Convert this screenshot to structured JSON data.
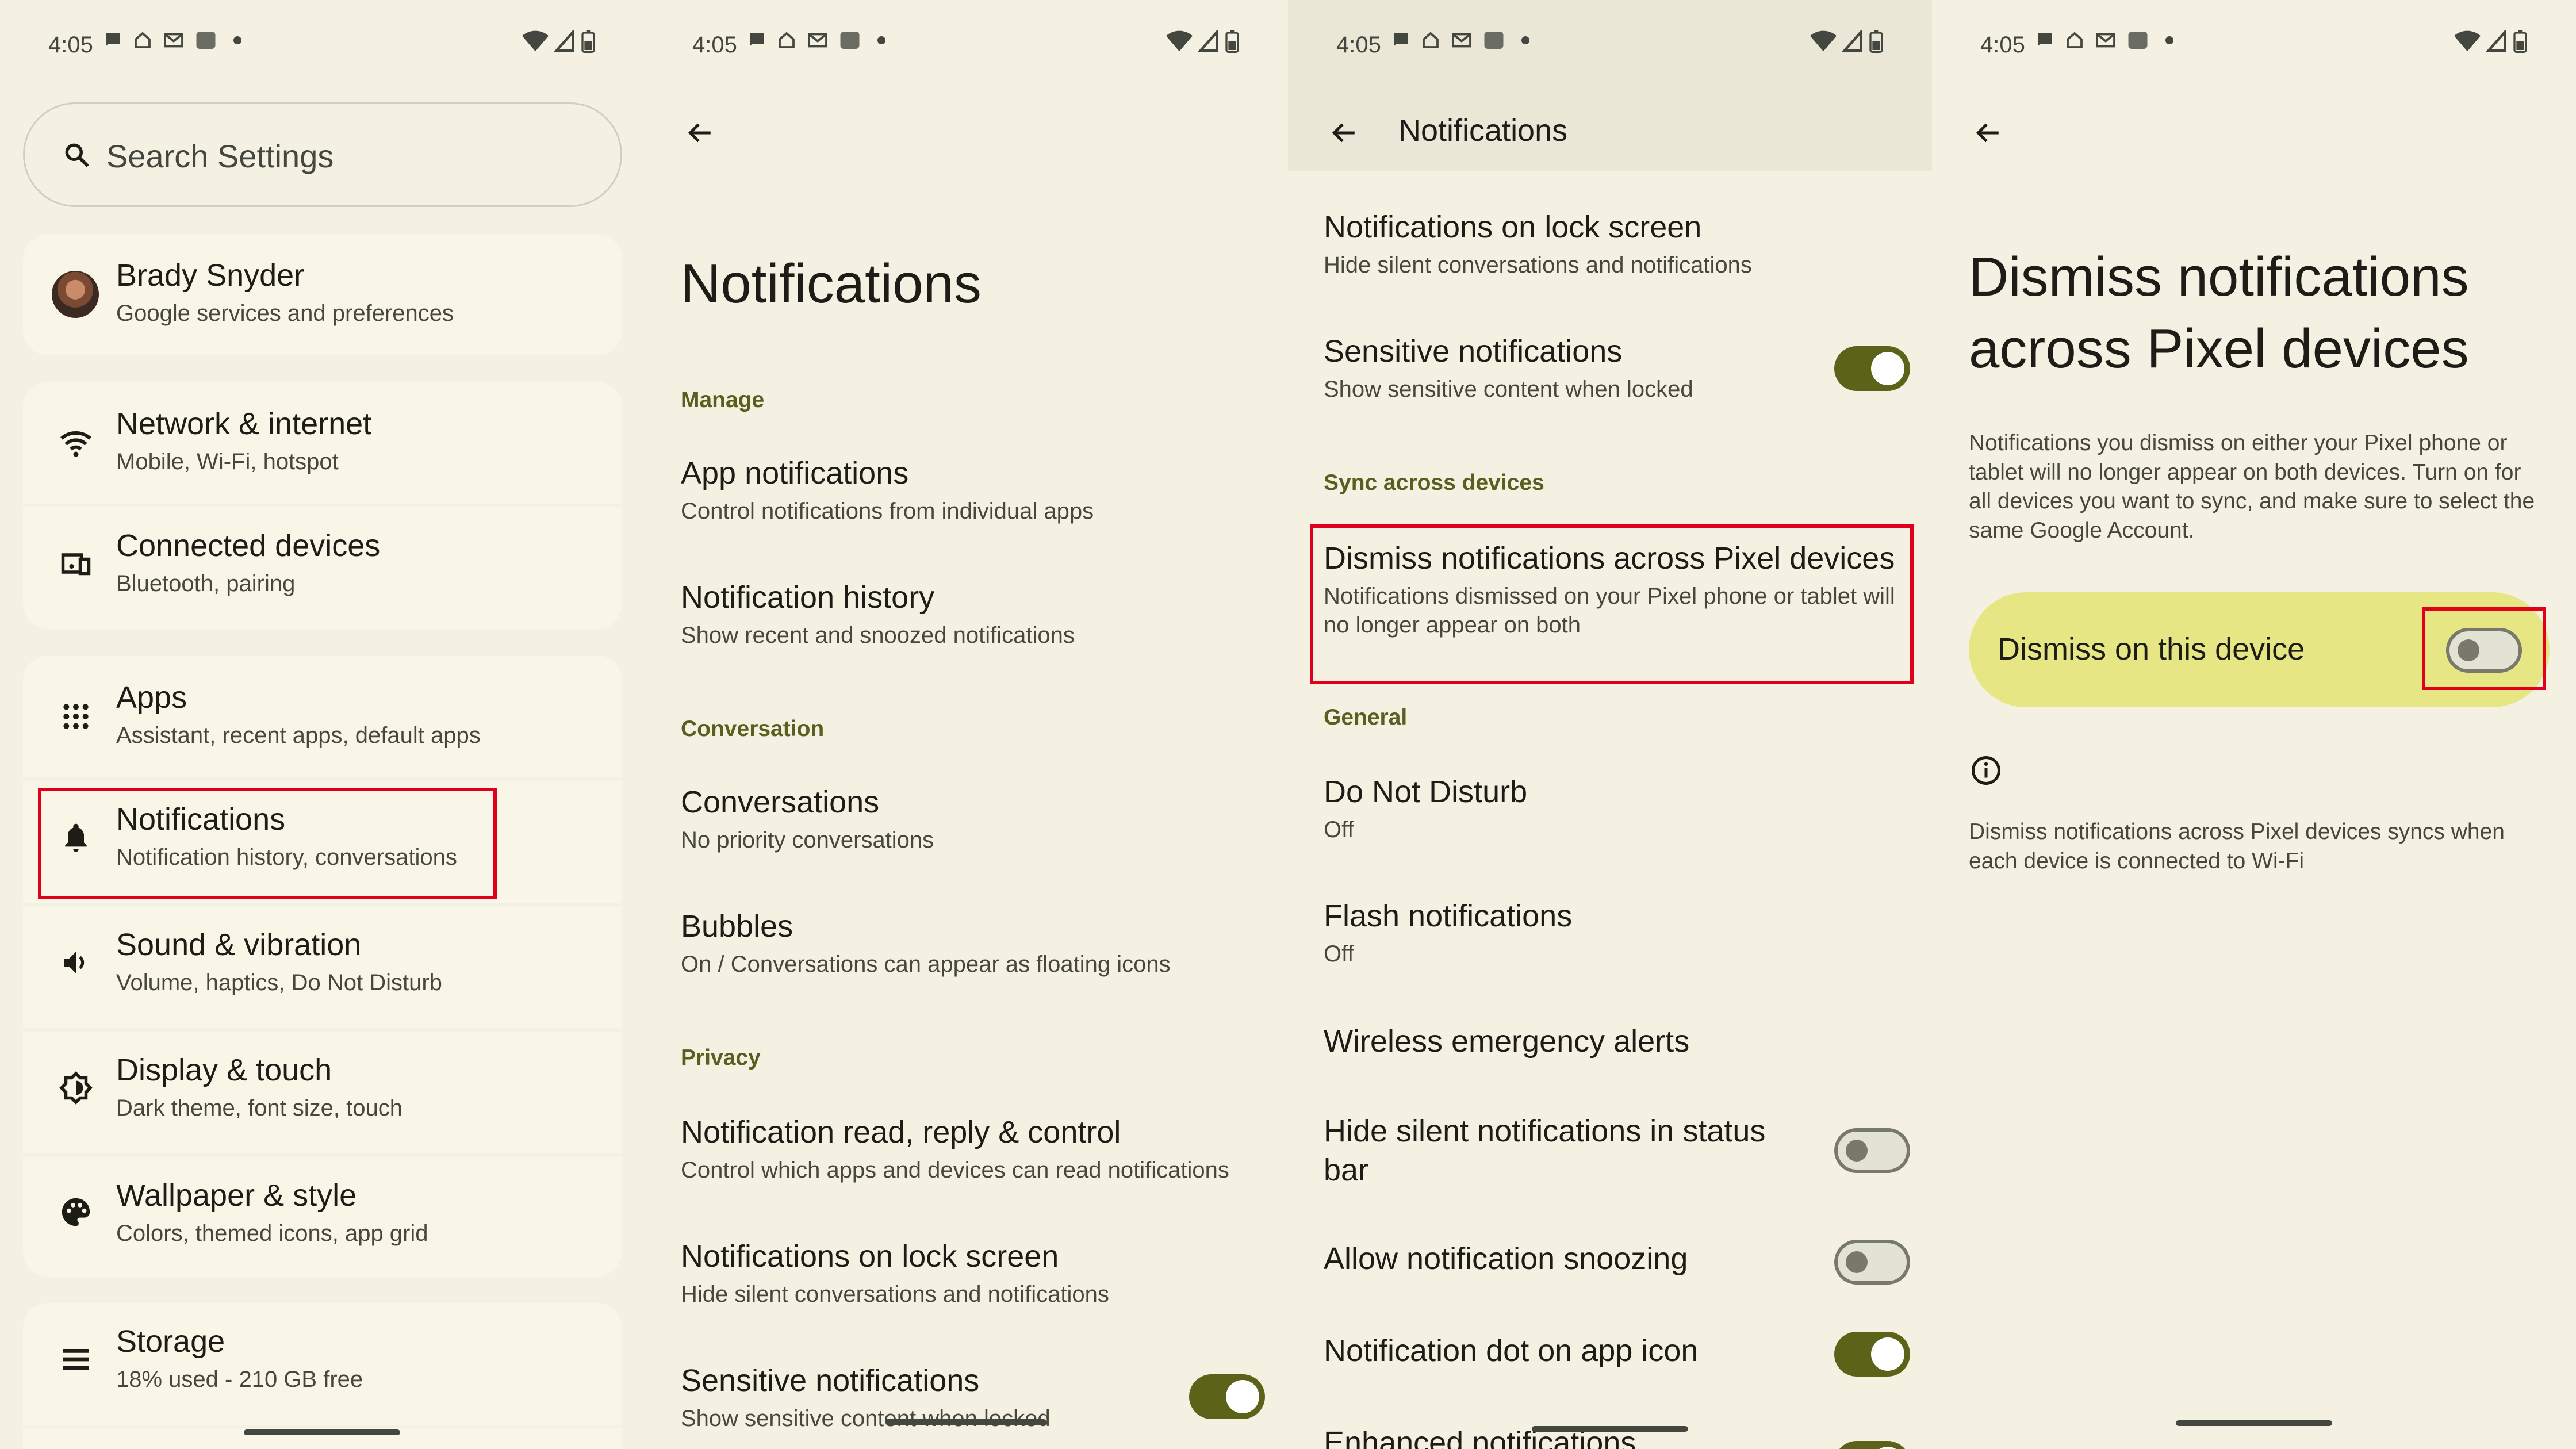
{
  "status_bar": {
    "time": "4:05"
  },
  "panel1": {
    "search_placeholder": "Search Settings",
    "account": {
      "name": "Brady Snyder",
      "subtitle": "Google services and preferences"
    },
    "items": [
      {
        "title": "Network & internet",
        "subtitle": "Mobile, Wi-Fi, hotspot",
        "icon": "wifi-icon"
      },
      {
        "title": "Connected devices",
        "subtitle": "Bluetooth, pairing",
        "icon": "devices-icon"
      },
      {
        "title": "Apps",
        "subtitle": "Assistant, recent apps, default apps",
        "icon": "apps-grid-icon"
      },
      {
        "title": "Notifications",
        "subtitle": "Notification history, conversations",
        "icon": "bell-icon"
      },
      {
        "title": "Sound & vibration",
        "subtitle": "Volume, haptics, Do Not Disturb",
        "icon": "speaker-icon"
      },
      {
        "title": "Display & touch",
        "subtitle": "Dark theme, font size, touch",
        "icon": "brightness-icon"
      },
      {
        "title": "Wallpaper & style",
        "subtitle": "Colors, themed icons, app grid",
        "icon": "palette-icon"
      },
      {
        "title": "Storage",
        "subtitle": "18% used - 210 GB free",
        "icon": "storage-icon"
      }
    ]
  },
  "panel2": {
    "title": "Notifications",
    "sections": {
      "manage": "Manage",
      "conversation": "Conversation",
      "privacy": "Privacy"
    },
    "items": [
      {
        "title": "App notifications",
        "subtitle": "Control notifications from individual apps"
      },
      {
        "title": "Notification history",
        "subtitle": "Show recent and snoozed notifications"
      },
      {
        "title": "Conversations",
        "subtitle": "No priority conversations"
      },
      {
        "title": "Bubbles",
        "subtitle": "On / Conversations can appear as floating icons"
      },
      {
        "title": "Notification read, reply & control",
        "subtitle": "Control which apps and devices can read notifications"
      },
      {
        "title": "Notifications on lock screen",
        "subtitle": "Hide silent conversations and notifications"
      },
      {
        "title": "Sensitive notifications",
        "subtitle": "Show sensitive content when locked",
        "toggle": "on"
      }
    ]
  },
  "panel3": {
    "header_title": "Notifications",
    "sections": {
      "sync": "Sync across devices",
      "general": "General"
    },
    "items": [
      {
        "title": "Notifications on lock screen",
        "subtitle": "Hide silent conversations and notifications"
      },
      {
        "title": "Sensitive notifications",
        "subtitle": "Show sensitive content when locked",
        "toggle": "on"
      },
      {
        "title": "Dismiss notifications across Pixel devices",
        "subtitle": "Notifications dismissed on your Pixel phone or tablet will no longer appear on both"
      },
      {
        "title": "Do Not Disturb",
        "subtitle": "Off"
      },
      {
        "title": "Flash notifications",
        "subtitle": "Off"
      },
      {
        "title": "Wireless emergency alerts"
      },
      {
        "title": "Hide silent notifications in status bar",
        "toggle": "off"
      },
      {
        "title": "Allow notification snoozing",
        "toggle": "off"
      },
      {
        "title": "Notification dot on app icon",
        "toggle": "on"
      },
      {
        "title": "Enhanced notifications",
        "toggle": "on"
      }
    ]
  },
  "panel4": {
    "title": "Dismiss notifications across Pixel devices",
    "description": "Notifications you dismiss on either your Pixel phone or tablet will no longer appear on both devices. Turn on for all devices you want to sync, and make sure to select the same Google Account.",
    "main_toggle_label": "Dismiss on this device",
    "main_toggle_state": "off",
    "footer_note": "Dismiss notifications across Pixel devices syncs when each device is connected to Wi-Fi"
  },
  "colors": {
    "background": "#f4f1e2",
    "accent": "#5c6319",
    "section_text": "#5a5e1e",
    "highlight_box": "#e0001b",
    "main_toggle_bg": "#e6e685"
  }
}
